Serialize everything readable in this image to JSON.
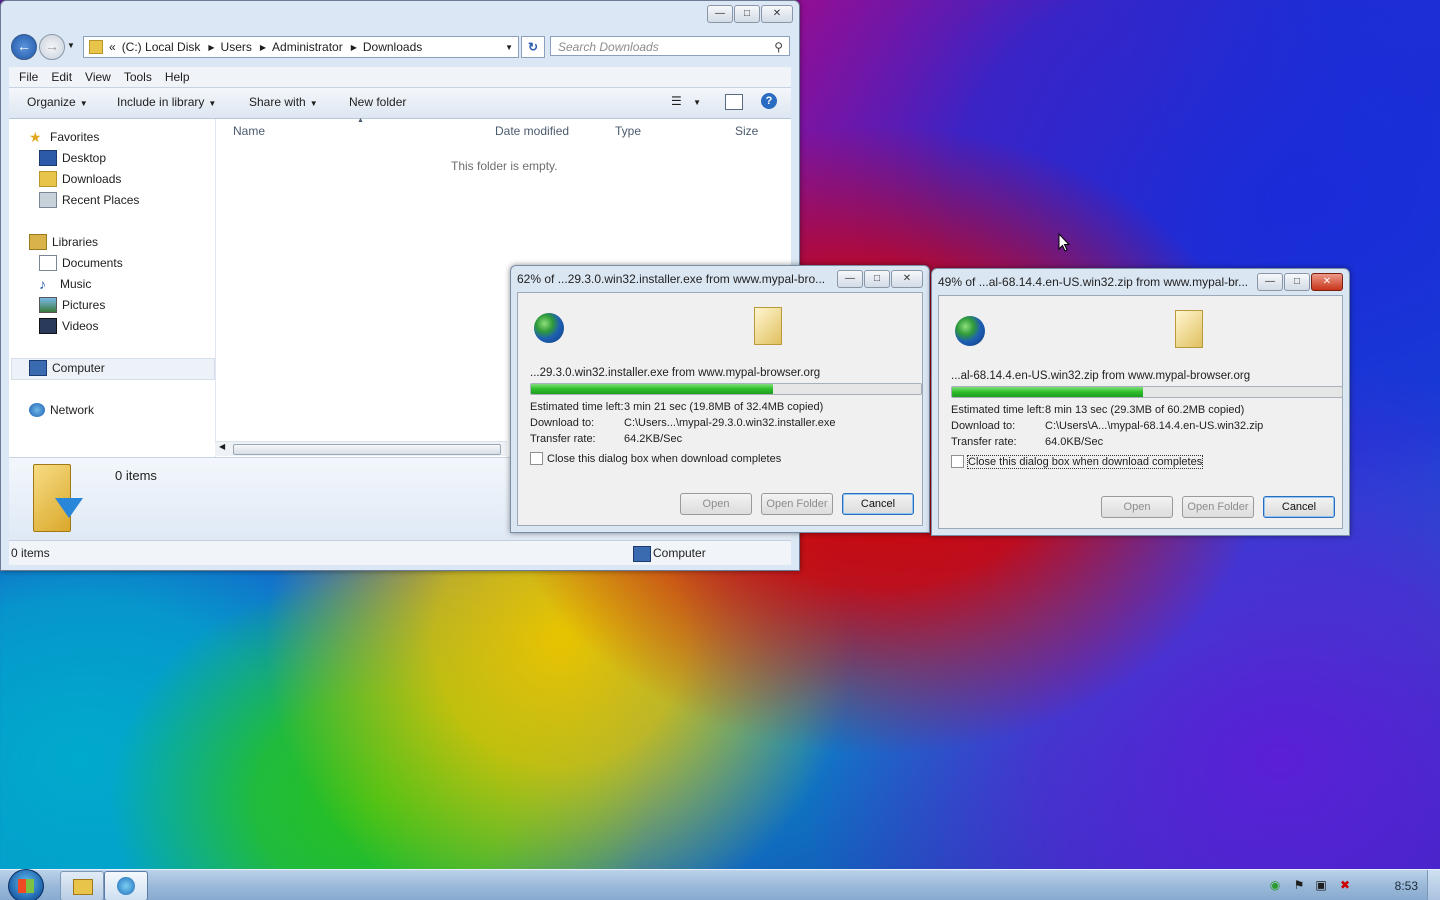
{
  "explorer": {
    "address": {
      "root": "«",
      "parts": [
        "(C:) Local Disk",
        "Users",
        "Administrator",
        "Downloads"
      ]
    },
    "search_placeholder": "Search Downloads",
    "menu": [
      "File",
      "Edit",
      "View",
      "Tools",
      "Help"
    ],
    "toolbar": {
      "organize": "Organize",
      "include": "Include in library",
      "share": "Share with",
      "newfolder": "New folder"
    },
    "nav": {
      "favorites": "Favorites",
      "desktop": "Desktop",
      "downloads": "Downloads",
      "recent": "Recent Places",
      "libraries": "Libraries",
      "documents": "Documents",
      "music": "Music",
      "pictures": "Pictures",
      "videos": "Videos",
      "computer": "Computer",
      "network": "Network"
    },
    "columns": {
      "name": "Name",
      "date": "Date modified",
      "type": "Type",
      "size": "Size"
    },
    "empty_message": "This folder is empty.",
    "details_count": "0 items",
    "status_count": "0 items",
    "status_location": "Computer"
  },
  "dialog1": {
    "title": "62% of ...29.3.0.win32.installer.exe from www.mypal-bro...",
    "file": "...29.3.0.win32.installer.exe from www.mypal-browser.org",
    "progress": 0.62,
    "time_label": "Estimated time left:",
    "time_value": "3 min 21 sec (19.8MB of 32.4MB copied)",
    "dest_label": "Download to:",
    "dest_value": "C:\\Users...\\mypal-29.3.0.win32.installer.exe",
    "rate_label": "Transfer rate:",
    "rate_value": "64.2KB/Sec",
    "close_check": "Close this dialog box when download completes",
    "open": "Open",
    "open_folder": "Open Folder",
    "cancel": "Cancel"
  },
  "dialog2": {
    "title": "49% of ...al-68.14.4.en-US.win32.zip from www.mypal-br...",
    "file": "...al-68.14.4.en-US.win32.zip from www.mypal-browser.org",
    "progress": 0.49,
    "time_label": "Estimated time left:",
    "time_value": "8 min 13 sec (29.3MB of 60.2MB copied)",
    "dest_label": "Download to:",
    "dest_value": "C:\\Users\\A...\\mypal-68.14.4.en-US.win32.zip",
    "rate_label": "Transfer rate:",
    "rate_value": "64.0KB/Sec",
    "close_check": "Close this dialog box when download completes",
    "open": "Open",
    "open_folder": "Open Folder",
    "cancel": "Cancel"
  },
  "taskbar": {
    "clock": "8:53"
  },
  "colors": {
    "progress": "#2dbd2a",
    "close_red": "#c8341a",
    "accent": "#2a6cc2"
  }
}
